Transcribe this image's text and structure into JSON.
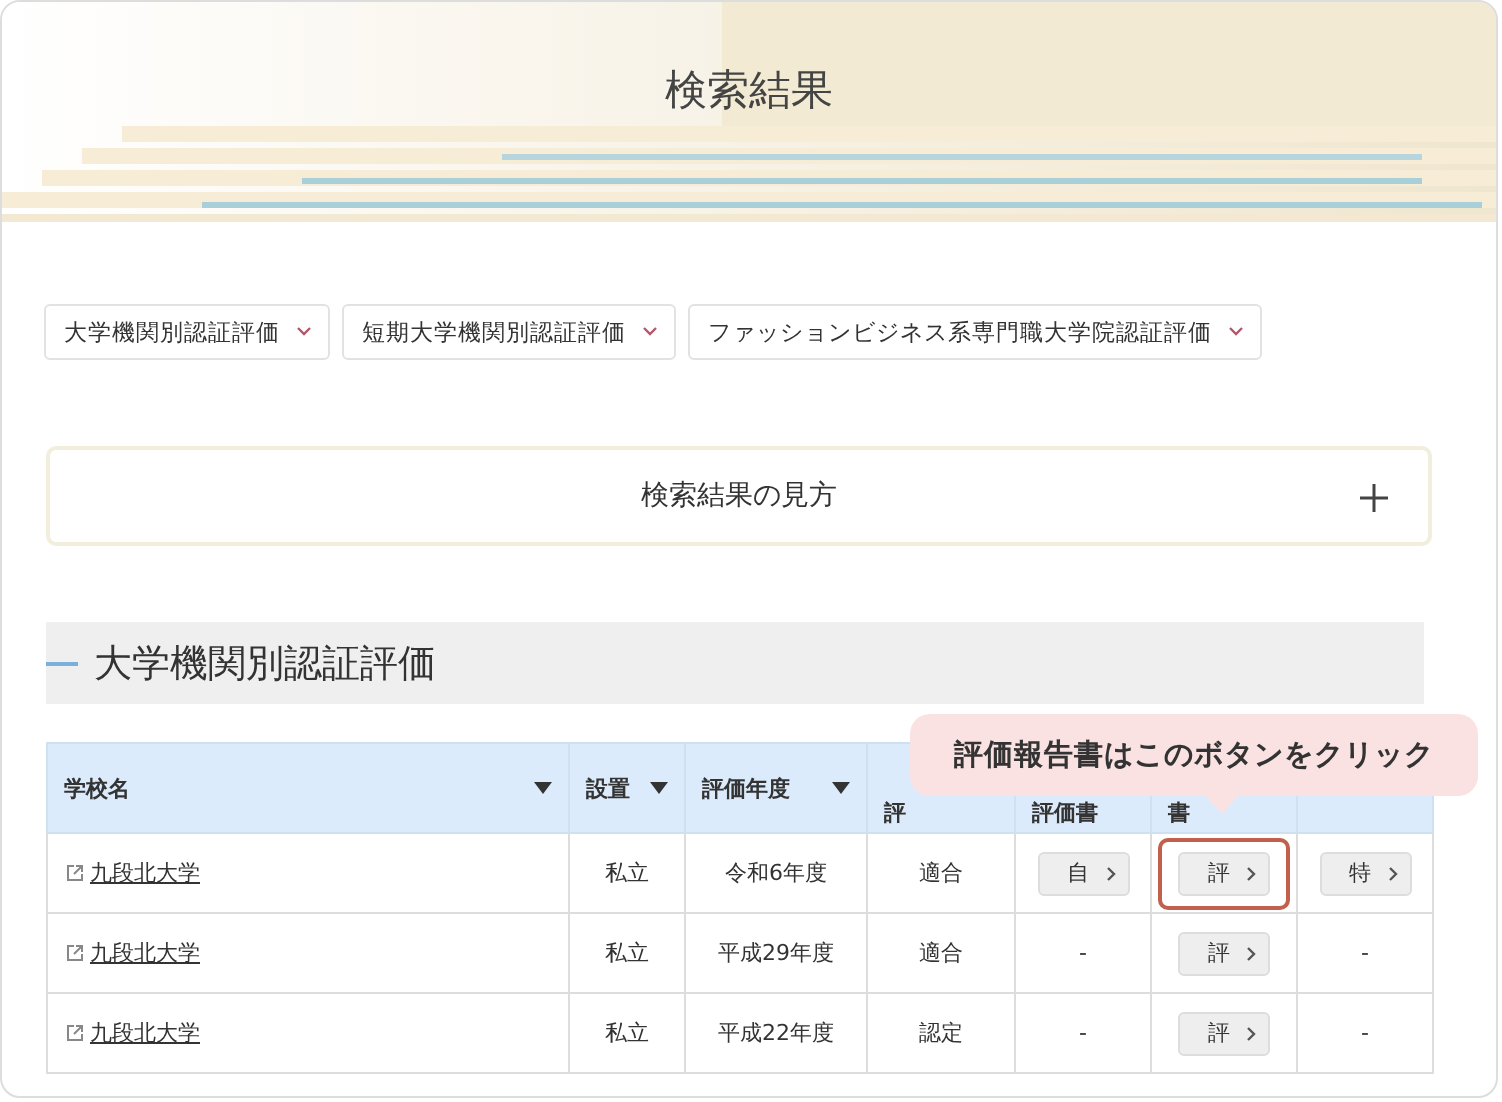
{
  "page_title": "検索結果",
  "filters": [
    {
      "label": "大学機関別認証評価"
    },
    {
      "label": "短期大学機関別認証評価"
    },
    {
      "label": "ファッションビジネス系専門職大学院認証評価"
    }
  ],
  "accordion": {
    "label": "検索結果の見方",
    "expanded": false
  },
  "section_title": "大学機関別認証評価",
  "tooltip": "評価報告書はこのボタンをクリック",
  "table": {
    "columns": [
      {
        "label": "学校名",
        "sortable": true
      },
      {
        "label": "設置",
        "sortable": true
      },
      {
        "label": "評価年度",
        "sortable": true
      },
      {
        "label": "評",
        "sortable": false
      },
      {
        "label": "評価書",
        "sortable": false
      },
      {
        "label": "書",
        "sortable": false
      },
      {}
    ],
    "rows": [
      {
        "cells": [
          {
            "kind": "link",
            "text": "九段北大学"
          },
          {
            "kind": "text",
            "text": "私立"
          },
          {
            "kind": "text",
            "text": "令和6年度"
          },
          {
            "kind": "text",
            "text": "適合"
          },
          {
            "kind": "button",
            "text": "自",
            "highlighted": false
          },
          {
            "kind": "button",
            "text": "評",
            "highlighted": true
          },
          {
            "kind": "button",
            "text": "特",
            "highlighted": false
          }
        ]
      },
      {
        "cells": [
          {
            "kind": "link",
            "text": "九段北大学"
          },
          {
            "kind": "text",
            "text": "私立"
          },
          {
            "kind": "text",
            "text": "平成29年度"
          },
          {
            "kind": "text",
            "text": "適合"
          },
          {
            "kind": "text",
            "text": "-"
          },
          {
            "kind": "button",
            "text": "評",
            "highlighted": false
          },
          {
            "kind": "text",
            "text": "-"
          }
        ]
      },
      {
        "cells": [
          {
            "kind": "link",
            "text": "九段北大学"
          },
          {
            "kind": "text",
            "text": "私立"
          },
          {
            "kind": "text",
            "text": "平成22年度"
          },
          {
            "kind": "text",
            "text": "認定"
          },
          {
            "kind": "text",
            "text": "-"
          },
          {
            "kind": "button",
            "text": "評",
            "highlighted": false
          },
          {
            "kind": "text",
            "text": "-"
          }
        ]
      }
    ]
  }
}
